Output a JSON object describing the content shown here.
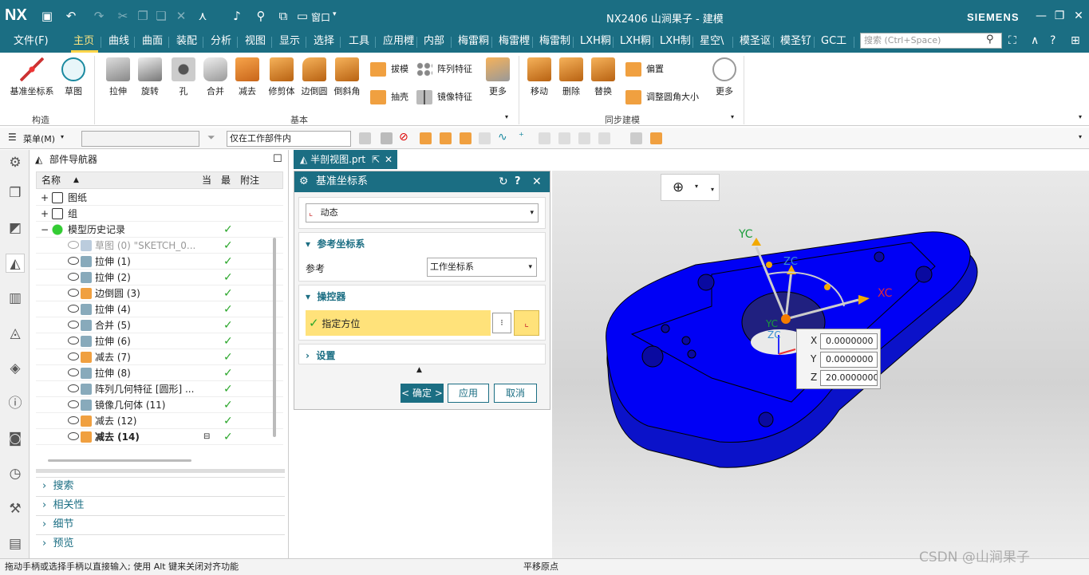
{
  "titlebar": {
    "logo": "NX",
    "window_title": "NX2406 山涧果子 - 建模",
    "brand": "SIEMENS",
    "window_menu_label": "窗口"
  },
  "menubar": {
    "tabs": [
      "文件(F)",
      "主页",
      "曲线",
      "曲面",
      "装配",
      "分析",
      "视图",
      "显示",
      "选择",
      "工具",
      "应用榸",
      "内部",
      "梅雷粡",
      "梅雷榸",
      "梅雷制",
      "LXH粡",
      "LXH粡",
      "LXH制",
      "星空\\",
      "模圣讴",
      "模圣钌",
      "GC工"
    ],
    "active": "主页",
    "search_placeholder": "搜索 (Ctrl+Space)"
  },
  "ribbon": {
    "group_construct": {
      "label": "构造",
      "buttons": [
        "基准坐标系",
        "草图"
      ]
    },
    "group_basic": {
      "label": "基本",
      "buttons": [
        "拉伸",
        "旋转",
        "孔",
        "合并",
        "减去",
        "修剪体",
        "边倒圆",
        "倒斜角"
      ],
      "small": [
        "拔模",
        "抽壳",
        "阵列特征",
        "镜像特征"
      ],
      "more": "更多"
    },
    "group_sync": {
      "label": "同步建模",
      "buttons": [
        "移动",
        "删除",
        "替换"
      ],
      "small": [
        "偏置",
        "调整圆角大小"
      ],
      "more": "更多"
    }
  },
  "toolrow": {
    "menu_label": "菜单(M)",
    "filter_value": "仅在工作部件内"
  },
  "navigator": {
    "title": "部件导航器",
    "columns": [
      "名称",
      "当",
      "最",
      "附注"
    ],
    "rows": [
      {
        "label": "图纸",
        "level": 1,
        "check": false
      },
      {
        "label": "组",
        "level": 1,
        "check": false
      },
      {
        "label": "模型历史记录",
        "level": 1,
        "check": true
      },
      {
        "label": "草图 (0) \"SKETCH_0...",
        "level": 2,
        "check": true,
        "dim": true
      },
      {
        "label": "拉伸 (1)",
        "level": 2,
        "check": true
      },
      {
        "label": "拉伸 (2)",
        "level": 2,
        "check": true
      },
      {
        "label": "边倒圆 (3)",
        "level": 2,
        "check": true
      },
      {
        "label": "拉伸 (4)",
        "level": 2,
        "check": true
      },
      {
        "label": "合并 (5)",
        "level": 2,
        "check": true
      },
      {
        "label": "拉伸 (6)",
        "level": 2,
        "check": true
      },
      {
        "label": "减去 (7)",
        "level": 2,
        "check": true
      },
      {
        "label": "拉伸 (8)",
        "level": 2,
        "check": true
      },
      {
        "label": "阵列几何特征 [圆形] ...",
        "level": 2,
        "check": true
      },
      {
        "label": "镜像几何体 (11)",
        "level": 2,
        "check": true
      },
      {
        "label": "减去 (12)",
        "level": 2,
        "check": true
      },
      {
        "label": "减去 (14)",
        "level": 2,
        "check": true,
        "bold": true
      }
    ],
    "sections": [
      "搜索",
      "相关性",
      "细节",
      "预览"
    ]
  },
  "part_tab": {
    "label": "半剖视图.prt"
  },
  "dialog": {
    "title": "基准坐标系",
    "type_value": "动态",
    "ref_section": "参考坐标系",
    "ref_label": "参考",
    "ref_value": "工作坐标系",
    "manip_section": "操控器",
    "manip_item": "指定方位",
    "settings_section": "设置",
    "ok": "< 确定 >",
    "apply": "应用",
    "cancel": "取消"
  },
  "viewport": {
    "axis_labels": {
      "yc": "YC",
      "zc": "ZC",
      "xc": "XC"
    },
    "coords": {
      "x": "0.0000000",
      "y": "0.0000000",
      "z": "20.0000000"
    }
  },
  "status": {
    "left": "拖动手柄或选择手柄以直接输入; 使用 Alt 键来关闭对齐功能",
    "center": "平移原点",
    "watermark": "CSDN @山涧果子"
  },
  "colors": {
    "accent": "#1b6e83",
    "part": "#0a14d8",
    "highlight": "#ffe27a"
  }
}
